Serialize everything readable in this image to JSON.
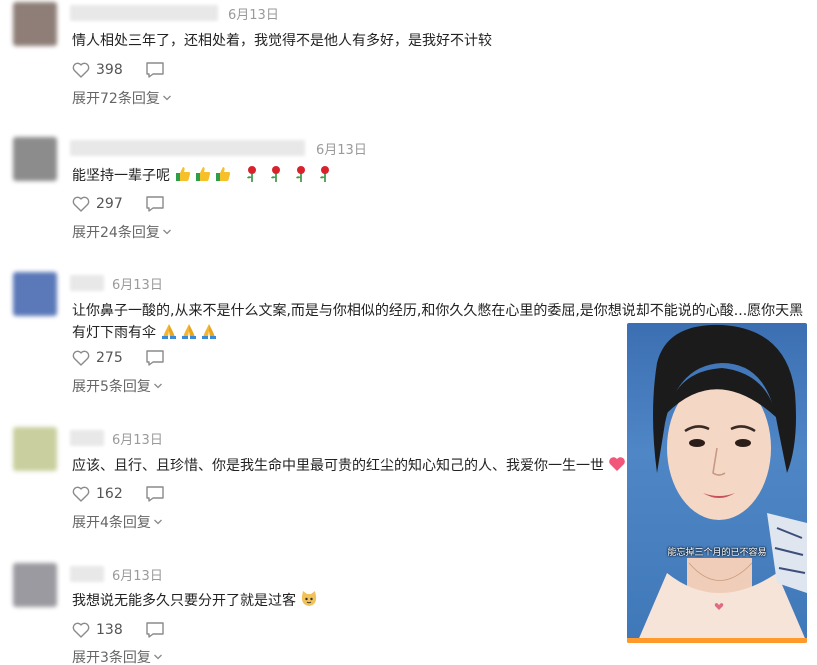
{
  "colors": {
    "heart_outline": "#8a8a8a",
    "emoji_heart": "#f2577a"
  },
  "comments": [
    {
      "date": "6月13日",
      "text": "情人相处三年了，还相处着，我觉得不是他人有多好，是我好不计较",
      "likes": "398",
      "expand": "展开72条回复"
    },
    {
      "date": "6月13日",
      "text": "能坚持一辈子呢",
      "likes": "297",
      "expand": "展开24条回复"
    },
    {
      "date": "6月13日",
      "text": "让你鼻子一酸的,从来不是什么文案,而是与你相似的经历,和你久久憋在心里的委屈,是你想说却不能说的心酸...愿你天黑有灯下雨有伞",
      "likes": "275",
      "expand": "展开5条回复"
    },
    {
      "date": "6月13日",
      "text": "应该、且行、且珍惜、你是我生命中里最可贵的红尘的知心知己的人、我爱你一生一世",
      "likes": "162",
      "expand": "展开4条回复"
    },
    {
      "date": "6月13日",
      "text": "我想说无能多久只要分开了就是过客",
      "likes": "138",
      "expand": "展开3条回复"
    }
  ],
  "photo": {
    "caption": "能忘掉三个月的已不容易"
  }
}
